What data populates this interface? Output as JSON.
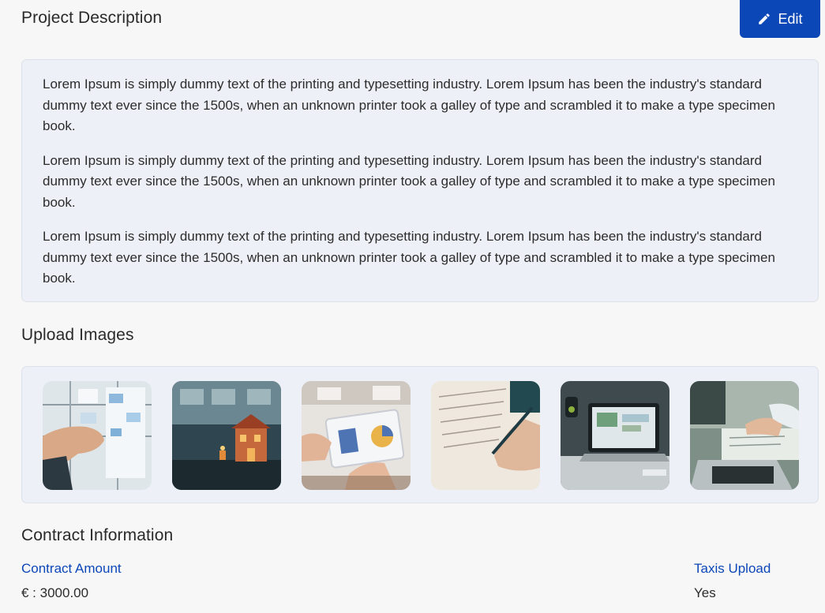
{
  "project_description": {
    "title": "Project Description",
    "edit_label": "Edit",
    "paragraphs": [
      "Lorem Ipsum is simply dummy text of the printing and typesetting industry. Lorem Ipsum has been the industry's standard dummy text ever since the 1500s, when an unknown printer took a galley of type and scrambled it to make a type specimen book.",
      "Lorem Ipsum is simply dummy text of the printing and typesetting industry. Lorem Ipsum has been the industry's standard dummy text ever since the 1500s, when an unknown printer took a galley of type and scrambled it to make a type specimen book.",
      "Lorem Ipsum is simply dummy text of the printing and typesetting industry. Lorem Ipsum has been the industry's standard dummy text ever since the 1500s, when an unknown printer took a galley of type and scrambled it to make a type specimen book."
    ]
  },
  "upload_images": {
    "title": "Upload Images",
    "images": [
      {
        "subject": "hand-pinning-sticky-notes-photo"
      },
      {
        "subject": "miniature-house-model-photo"
      },
      {
        "subject": "hands-holding-tablet-charts-photo"
      },
      {
        "subject": "hand-writing-in-notebook-photo"
      },
      {
        "subject": "laptop-on-desk-photo"
      },
      {
        "subject": "laptop-and-paperwork-photo"
      }
    ]
  },
  "contract_information": {
    "title": "Contract Information",
    "contract_amount_label": "Contract Amount",
    "contract_amount_value": "€ : 3000.00",
    "taxis_upload_label": "Taxis Upload",
    "taxis_upload_value": "Yes"
  },
  "colors": {
    "accent": "#0c47b7",
    "card_background": "#edf0f6",
    "page_background": "#f7f7f8"
  }
}
